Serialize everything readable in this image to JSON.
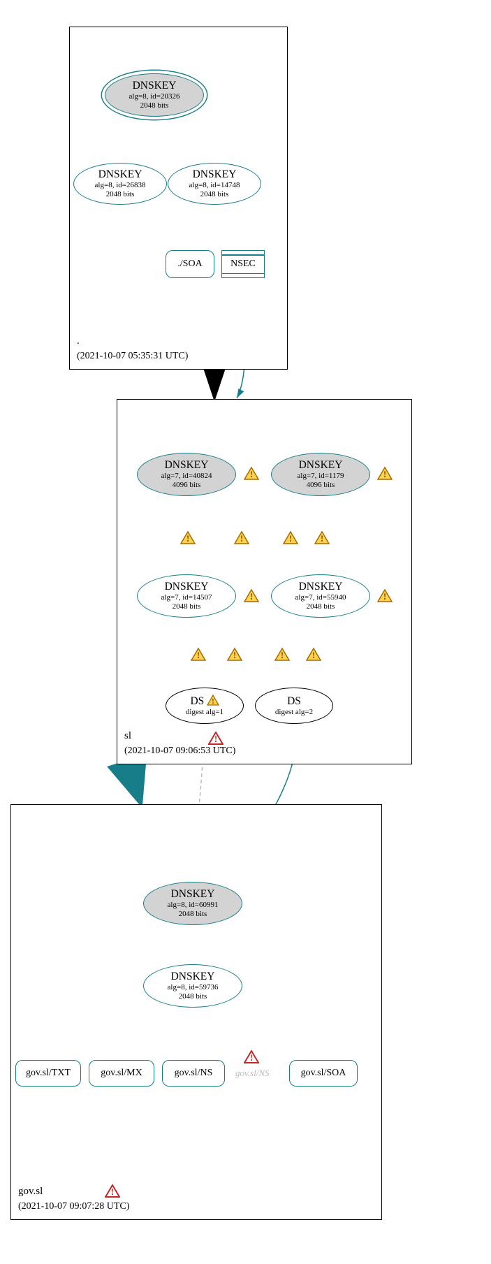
{
  "zones": {
    "root": {
      "name": ".",
      "timestamp": "(2021-10-07 05:35:31 UTC)"
    },
    "sl": {
      "name": "sl",
      "timestamp": "(2021-10-07 09:06:53 UTC)"
    },
    "gov": {
      "name": "gov.sl",
      "timestamp": "(2021-10-07 09:07:28 UTC)"
    }
  },
  "nodes": {
    "root_ksk": {
      "title": "DNSKEY",
      "line2": "alg=8, id=20326",
      "line3": "2048 bits"
    },
    "root_zsk1": {
      "title": "DNSKEY",
      "line2": "alg=8, id=26838",
      "line3": "2048 bits"
    },
    "root_zsk2": {
      "title": "DNSKEY",
      "line2": "alg=8, id=14748",
      "line3": "2048 bits"
    },
    "root_soa": {
      "label": "./SOA"
    },
    "root_nsec": {
      "label": "NSEC"
    },
    "sl_ksk1": {
      "title": "DNSKEY",
      "line2": "alg=7, id=40824",
      "line3": "4096 bits"
    },
    "sl_ksk2": {
      "title": "DNSKEY",
      "line2": "alg=7, id=1179",
      "line3": "4096 bits"
    },
    "sl_zsk1": {
      "title": "DNSKEY",
      "line2": "alg=7, id=14507",
      "line3": "2048 bits"
    },
    "sl_zsk2": {
      "title": "DNSKEY",
      "line2": "alg=7, id=55940",
      "line3": "2048 bits"
    },
    "sl_ds1": {
      "title": "DS",
      "line2": "digest alg=1"
    },
    "sl_ds2": {
      "title": "DS",
      "line2": "digest alg=2"
    },
    "gov_ksk": {
      "title": "DNSKEY",
      "line2": "alg=8, id=60991",
      "line3": "2048 bits"
    },
    "gov_zsk": {
      "title": "DNSKEY",
      "line2": "alg=8, id=59736",
      "line3": "2048 bits"
    },
    "gov_txt": {
      "label": "gov.sl/TXT"
    },
    "gov_mx": {
      "label": "gov.sl/MX"
    },
    "gov_ns": {
      "label": "gov.sl/NS"
    },
    "gov_ns_ghost": {
      "label": "gov.sl/NS"
    },
    "gov_soa": {
      "label": "gov.sl/SOA"
    }
  }
}
